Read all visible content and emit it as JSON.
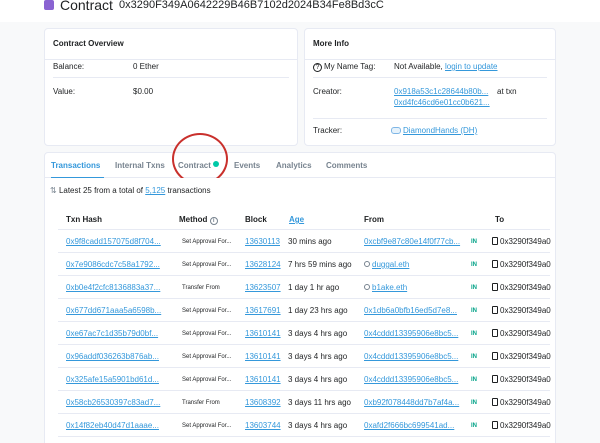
{
  "header": {
    "title": "Contract",
    "address": "0x3290F349A0642229B46B7102d2024B34Fe8Bd3cC"
  },
  "overview": {
    "title": "Contract Overview",
    "balance_label": "Balance:",
    "balance_value": "0 Ether",
    "value_label": "Value:",
    "value_value": "$0.00"
  },
  "more_info": {
    "title": "More Info",
    "name_tag_label": "My Name Tag:",
    "name_tag_value": "Not Available,",
    "name_tag_link": "login to update",
    "creator_label": "Creator:",
    "creator_address": "0x918a53c1c28644b80b...",
    "creator_at": "at txn",
    "creator_txn": "0xd4fc46cd6e01cc0b621...",
    "tracker_label": "Tracker:",
    "tracker_value": "DiamondHands (DH)"
  },
  "tabs": [
    "Transactions",
    "Internal Txns",
    "Contract",
    "Events",
    "Analytics",
    "Comments"
  ],
  "summary": {
    "prefix": "Latest 25 from a total of",
    "count": "5,125",
    "suffix": "transactions"
  },
  "table": {
    "headers": [
      "Txn Hash",
      "Method",
      "Block",
      "Age",
      "From",
      "To"
    ],
    "rows": [
      {
        "hash": "0x9f8cadd157075d8f704...",
        "method": "Set Approval For...",
        "block": "13630113",
        "age": "30 mins ago",
        "from": "0xcbf9e87c80e14f0f77cb...",
        "dir": "IN",
        "to": "0x3290f349a0"
      },
      {
        "hash": "0x7e9086cdc7c58a1792...",
        "method": "Set Approval For...",
        "block": "13628124",
        "age": "7 hrs 59 mins ago",
        "from": "duggal.eth",
        "dir": "IN",
        "to": "0x3290f349a0"
      },
      {
        "hash": "0xb0e4f2cfc8136883a37...",
        "method": "Transfer From",
        "block": "13623507",
        "age": "1 day 1 hr ago",
        "from": "b1ake.eth",
        "dir": "IN",
        "to": "0x3290f349a0"
      },
      {
        "hash": "0x677dd671aaa5a6598b...",
        "method": "Set Approval For...",
        "block": "13617691",
        "age": "1 day 23 hrs ago",
        "from": "0x1db6a0bfb16ed5d7e8...",
        "dir": "IN",
        "to": "0x3290f349a0"
      },
      {
        "hash": "0xe67ac7c1d35b79d0bf...",
        "method": "Set Approval For...",
        "block": "13610141",
        "age": "3 days 4 hrs ago",
        "from": "0x4cddd13395906e8bc5...",
        "dir": "IN",
        "to": "0x3290f349a0"
      },
      {
        "hash": "0x96addf036263b876ab...",
        "method": "Set Approval For...",
        "block": "13610141",
        "age": "3 days 4 hrs ago",
        "from": "0x4cddd13395906e8bc5...",
        "dir": "IN",
        "to": "0x3290f349a0"
      },
      {
        "hash": "0x325afe15a5901bd61d...",
        "method": "Set Approval For...",
        "block": "13610141",
        "age": "3 days 4 hrs ago",
        "from": "0x4cddd13395906e8bc5...",
        "dir": "IN",
        "to": "0x3290f349a0"
      },
      {
        "hash": "0x58cb26530397c83ad7...",
        "method": "Transfer From",
        "block": "13608392",
        "age": "3 days 11 hrs ago",
        "from": "0xb92f078448dd7b7af4a...",
        "dir": "IN",
        "to": "0x3290f349a0"
      },
      {
        "hash": "0x14f82eb40d47d1aaae...",
        "method": "Set Approval For...",
        "block": "13603744",
        "age": "3 days 4 hrs ago",
        "from": "0xafd2f666bc699541ad...",
        "dir": "IN",
        "to": "0x3290f349a0"
      }
    ]
  },
  "colors": {
    "link": "#3498db",
    "accent_success": "#00c9a7",
    "highlight_circle": "#c9302c"
  }
}
